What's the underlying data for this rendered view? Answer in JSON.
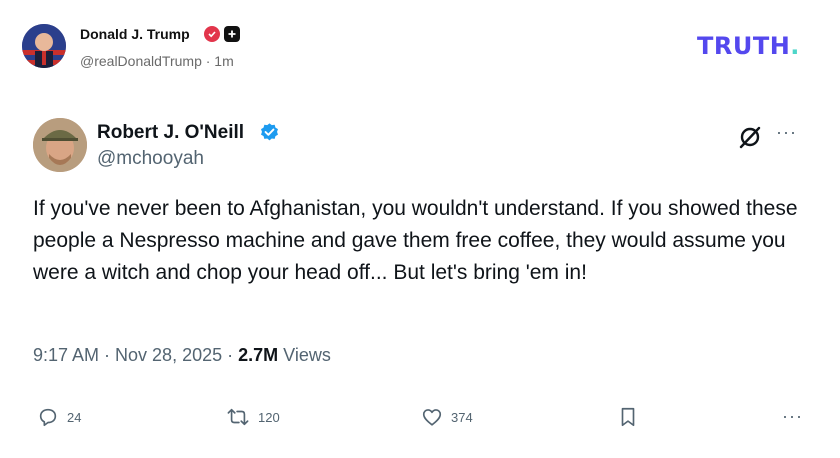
{
  "truth_post": {
    "author_name": "Donald J. Trump",
    "handle_time": "@realDonaldTrump · 1m",
    "brand_logo": "TRUTH",
    "brand_dot": ".",
    "badges": [
      "verified-red-icon",
      "plus-icon"
    ]
  },
  "tweet": {
    "author_name": "Robert J. O'Neill",
    "handle": "@mchooyah",
    "text": "If you've never been to Afghanistan, you wouldn't understand. If you showed these people a Nespresso machine and gave them free coffee, they would assume you were a witch and chop your head off... But let's bring 'em in!",
    "time_date": "9:17 AM · Nov 28, 2025 · ",
    "views_count": "2.7M",
    "views_label": " Views",
    "more_icon": "···"
  },
  "actions": {
    "replies": "24",
    "reposts": "120",
    "likes": "374",
    "more": "···"
  },
  "colors": {
    "truth_brand": "#5448ee",
    "truth_dot": "#4dd6c9",
    "x_verified": "#1d9bf0",
    "truth_verified": "#e2354b",
    "secondary_text": "#536471"
  }
}
